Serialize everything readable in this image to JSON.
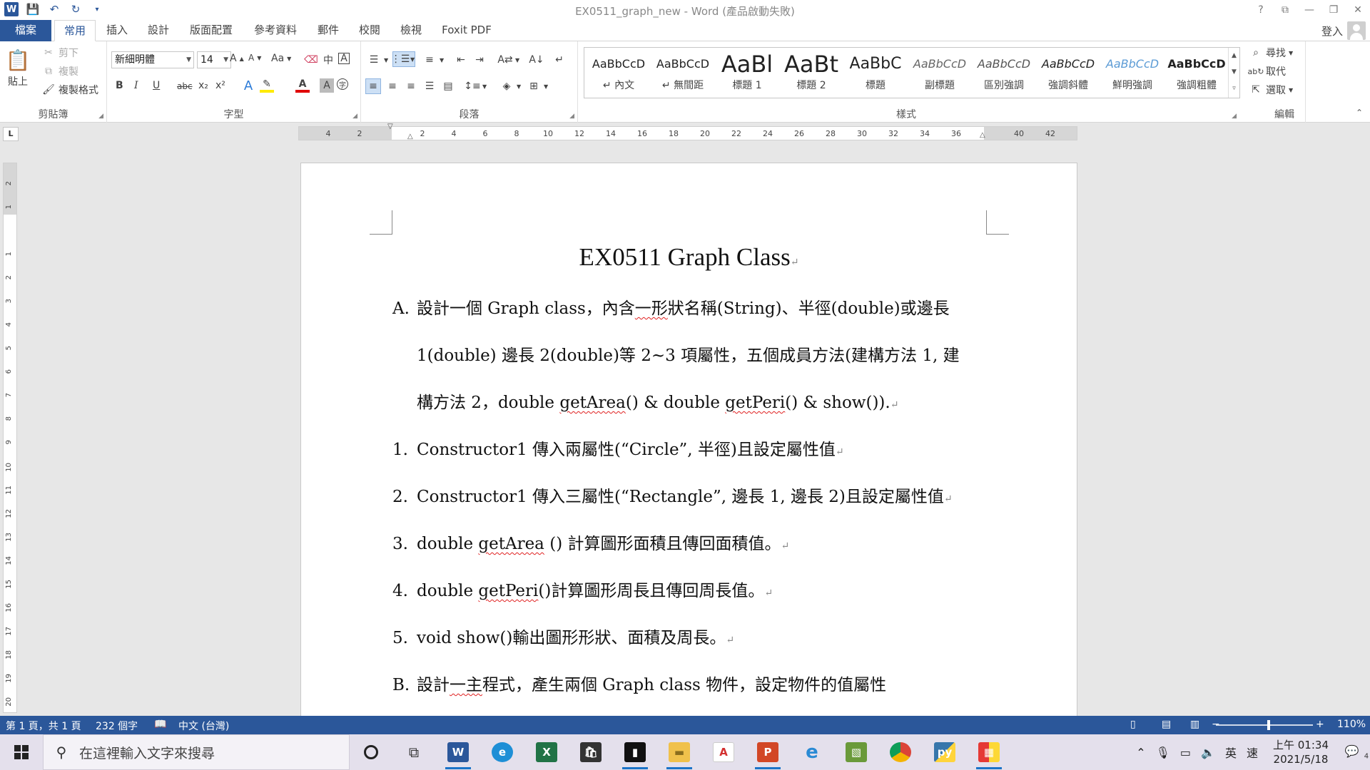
{
  "titlebar": {
    "title": "EX0511_graph_new - Word (產品啟動失敗)",
    "help": "?",
    "ribbon_display": "⧉",
    "minimize": "—",
    "restore": "❐",
    "close": "✕"
  },
  "tabs": {
    "file": "檔案",
    "home": "常用",
    "insert": "插入",
    "design": "設計",
    "layout": "版面配置",
    "references": "參考資料",
    "mailings": "郵件",
    "review": "校閱",
    "view": "檢視",
    "foxit": "Foxit PDF",
    "signin": "登入"
  },
  "clipboard": {
    "paste": "貼上",
    "cut": "剪下",
    "copy": "複製",
    "format_painter": "複製格式",
    "label": "剪貼簿"
  },
  "font": {
    "name": "新細明體",
    "size": "14",
    "grow": "A",
    "shrink": "A",
    "case": "Aa",
    "bold": "B",
    "italic": "I",
    "underline": "U",
    "strike": "abc",
    "subscript": "x₂",
    "superscript": "x²",
    "label": "字型"
  },
  "paragraph": {
    "label": "段落"
  },
  "styles": {
    "items": [
      {
        "sample": "AaBbCcD",
        "name": "↵ 內文"
      },
      {
        "sample": "AaBbCcD",
        "name": "↵ 無間距"
      },
      {
        "sample": "AaBl",
        "name": "標題 1"
      },
      {
        "sample": "AaBt",
        "name": "標題 2"
      },
      {
        "sample": "AaBbC",
        "name": "標題"
      },
      {
        "sample": "AaBbCcD",
        "name": "副標題"
      },
      {
        "sample": "AaBbCcD",
        "name": "區別強調"
      },
      {
        "sample": "AaBbCcD",
        "name": "強調斜體"
      },
      {
        "sample": "AaBbCcD",
        "name": "鮮明強調"
      },
      {
        "sample": "AaBbCcD",
        "name": "強調粗體"
      }
    ],
    "label": "樣式"
  },
  "editing": {
    "find": "尋找",
    "replace": "取代",
    "select": "選取",
    "label": "編輯"
  },
  "ruler": {
    "tab_selector": "L",
    "h_ticks": [
      "4",
      "2",
      "2",
      "4",
      "6",
      "8",
      "10",
      "12",
      "14",
      "16",
      "18",
      "20",
      "22",
      "24",
      "26",
      "28",
      "30",
      "32",
      "34",
      "36",
      "40",
      "42"
    ],
    "v_ticks": [
      "2",
      "1",
      "1",
      "2",
      "3",
      "4",
      "5",
      "6",
      "7",
      "8",
      "9",
      "10",
      "11",
      "12",
      "13",
      "14",
      "15",
      "16",
      "17",
      "18",
      "19",
      "20"
    ]
  },
  "document": {
    "title": "EX0511 Graph Class",
    "lines": {
      "a_marker": "A.",
      "a1_p1": "設計一個 Graph class，內含",
      "a1_p2": "一形",
      "a1_p3": "狀名稱(String)、半徑(double)或邊長",
      "a2": "1(double)  邊長 2(double)等 2~3 項屬性，五個成員方法(建構方法 1, 建",
      "a3_p1": "構方法 2，double ",
      "a3_sq1": "getArea",
      "a3_p2": "() & double ",
      "a3_sq2": "getPeri",
      "a3_p3": "() & show()).",
      "n1_marker": "1.",
      "n1": "Constructor1  傳入兩屬性(“Circle”, 半徑)且設定屬性值",
      "n2_marker": "2.",
      "n2": "Constructor1  傳入三屬性(“Rectangle”, 邊長 1, 邊長 2)且設定屬性值",
      "n3_marker": "3.",
      "n3_p1": "double ",
      "n3_sq": "getArea",
      "n3_p2": " ()  計算圖形面積且傳回面積值。",
      "n4_marker": "4.",
      "n4_p1": "double ",
      "n4_sq": "getPeri",
      "n4_p2": "()計算圖形周長且傳回周長值。",
      "n5_marker": "5.",
      "n5": "void show()輸出圖形形狀、面積及周長。",
      "b_marker": "B.",
      "b_p1": "設計",
      "b_sq": "一主",
      "b_p2": "程式，產生兩個 Graph class 物件，設定物件的值屬性"
    },
    "para_mark": "↵"
  },
  "statusbar": {
    "page": "第 1 頁，共 1 頁",
    "words": "232 個字",
    "language": "中文 (台灣)",
    "zoom": "110%",
    "zoom_minus": "−",
    "zoom_plus": "+"
  },
  "taskbar": {
    "search_placeholder": "在這裡輸入文字來搜尋",
    "ime_lang": "英",
    "ime_mode": "速",
    "time": "上午 01:34",
    "date": "2021/5/18",
    "notifications": "4"
  },
  "colors": {
    "word_blue": "#2b579a",
    "status_blue": "#2b579a",
    "spell_red": "#e02020"
  }
}
